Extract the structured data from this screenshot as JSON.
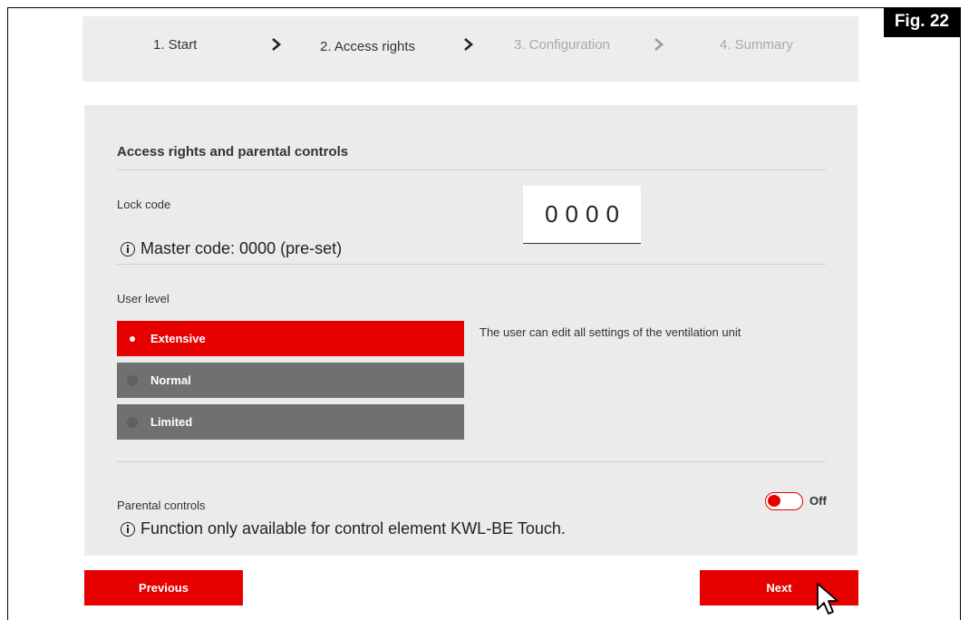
{
  "figure_label": "Fig. 22",
  "steps": [
    {
      "label": "1. Start",
      "state": "completed"
    },
    {
      "label": "2. Access rights",
      "state": "current"
    },
    {
      "label": "3. Configuration",
      "state": "upcoming"
    },
    {
      "label": "4. Summary",
      "state": "upcoming"
    }
  ],
  "panel": {
    "title": "Access rights and parental controls",
    "lock_code": {
      "label": "Lock code",
      "digits": [
        "0",
        "0",
        "0",
        "0"
      ],
      "info": "Master code: 0000 (pre-set)"
    },
    "user_level": {
      "label": "User level",
      "options": [
        {
          "label": "Extensive",
          "selected": true
        },
        {
          "label": "Normal",
          "selected": false
        },
        {
          "label": "Limited",
          "selected": false
        }
      ],
      "description": "The user can edit all settings of the ventilation unit"
    },
    "parental_controls": {
      "label": "Parental controls",
      "toggle_state": "Off",
      "info": "Function only available for control element KWL-BE Touch."
    }
  },
  "buttons": {
    "previous": "Previous",
    "next": "Next"
  },
  "colors": {
    "accent": "#e60000",
    "inactive_button": "#707070",
    "panel_bg": "#ebebeb"
  }
}
